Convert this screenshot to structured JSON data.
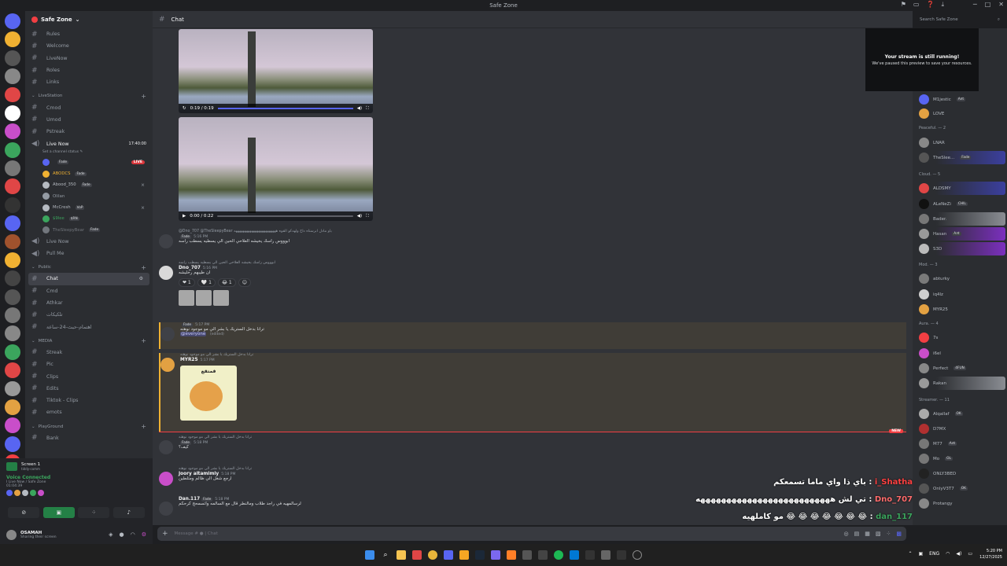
{
  "window": {
    "title": "Safe Zone",
    "controls": [
      "─",
      "□",
      "✕"
    ],
    "top_icons": [
      "⚑",
      "▭",
      "❓",
      "⤓"
    ]
  },
  "server": {
    "name": "Safe Zone",
    "name_suffix": "⌄"
  },
  "channels_top": [
    "Rules",
    "Welcome",
    "LiveNow",
    "Roles",
    "Links"
  ],
  "category_livestation": "LiveStation",
  "channels_livestation": [
    "Cmod",
    "Umod",
    "Pstreak"
  ],
  "voice_live_now": {
    "name": "Live Now",
    "count": "17:40:00",
    "status": "Set a channel status ✎"
  },
  "voice_users": [
    {
      "name": "",
      "tag": "Fade",
      "live": "LIVE",
      "color": "#5865f2"
    },
    {
      "name": "ABODCS",
      "tag": "Fade",
      "color": "#f0b132"
    },
    {
      "name": "Abood_350",
      "tag": "Fade",
      "color": "#b5bac1",
      "mute": "⨯"
    },
    {
      "name": "Olilan",
      "color": "#949ba4"
    },
    {
      "name": "McCresh",
      "tag": "VoP",
      "color": "#b5bac1",
      "mute": "⨯"
    },
    {
      "name": "$9lee",
      "tag": "$RN",
      "color": "#3ba55d"
    },
    {
      "name": "TheSleepyBear",
      "tag": "Fade",
      "color": "#72767d"
    }
  ],
  "voice_extra": [
    "Live Now",
    "Pull Me"
  ],
  "category_public": "Public",
  "channels_public": [
    "Chat",
    "Cmd",
    "Athkar",
    "تلكيكات",
    "اهتمام-حبث-24-ساعة"
  ],
  "category_media": "MEDIA",
  "channels_media": [
    "Streak",
    "Pic",
    "Clips",
    "Edits",
    "Tiktok - Clips",
    "emots"
  ],
  "category_playground": "PlayGround",
  "channels_playground": [
    "Bank"
  ],
  "screen_share": {
    "title": "Screen 1",
    "sub": "tiddy-comm"
  },
  "voice_connected": {
    "label": "Voice Connected",
    "channel": "I Live Now / Safe Zone",
    "time": "01:04:39"
  },
  "user": {
    "name": "OSAMAH",
    "status": "Sharing their screen"
  },
  "chat_header": {
    "channel": "Chat"
  },
  "search": {
    "placeholder": "Search Safe Zone",
    "icon": "⌕"
  },
  "videos": [
    {
      "time": "0:19 / 0:19",
      "progress": 1.0
    },
    {
      "time": "0:00 / 0:22",
      "progress": 0.0
    }
  ],
  "messages": [
    {
      "reply": "@Dno_707 @TheSleepyBear ياو مادل ابرستاه داخ ولهدكو القوه ههههههههههههههههههههههههه",
      "name": "",
      "tag": "Fade",
      "time": "5:16 PM",
      "text": "ابوووس راسك يخيشه العلاحي الحين الي يسطيه يسطب راسه",
      "avatar": "#3f4147"
    },
    {
      "reply": "ابوووس راسك يخيشه العلاحي الحين الي يسطيه يسطب راسه",
      "name": "Dno_707",
      "tag": "",
      "time": "5:16 PM",
      "text": "ان طيبهم رخليشه",
      "avatar": "#d9d9d9",
      "reactions": [
        "❤ 1",
        "🤍 1",
        "😂 1"
      ]
    },
    {
      "reply": "",
      "name": "",
      "tag": "Fade",
      "time": "5:17 PM",
      "text": "ترانا بدخل الستريك يا بشر الي مو موجود نوهته",
      "mention": "@everyone",
      "edited": "(edited)",
      "avatar": "#3f4147"
    },
    {
      "reply": "ترانا بدخل الستريك يا بشر الي مو موجود نوهته",
      "name": "MYR25",
      "tag": "",
      "time": "5:17 PM",
      "text": "",
      "sticker": "قمتقع",
      "avatar": "#e3a142"
    },
    {
      "reply": "ترانا بدخل الستريك يا بشر الي مو موجود نوهته",
      "name": "",
      "tag": "Fade",
      "time": "5:18 PM",
      "text": "كيف؟",
      "avatar": "#3f4147"
    },
    {
      "reply": "ترانا بدخل الستريك يا بشر الي مو موجود نوهته",
      "name": "Joory altamimiy",
      "tag": "",
      "time": "5:18 PM",
      "text": "ارجع شغل الي ظالم ومتلطين",
      "avatar": "#c94ec9"
    },
    {
      "reply": "",
      "name": "Dan.117",
      "tag": "Fade",
      "time": "5:18 PM",
      "text": "لرسالمهيه في راجد طلاب ومالنطر قال مع السالمه واتسمحح كرحكم",
      "avatar": "#3f4147"
    }
  ],
  "new_badge": "NEW",
  "composer": {
    "placeholder": "Message # ● | Chat"
  },
  "overlay": [
    {
      "name": "i_Shatha",
      "text": "باي ذا واي ماما تسمعكم :",
      "color": "#ff4040"
    },
    {
      "name": "Dno_707",
      "text": "تي لش ههههههههههههههههههههههههههه :",
      "color": "#ff6b6b"
    },
    {
      "name": "dan_117",
      "text": "مو كاملهيه 😂 😂 😂 😂 😂 😂 😂 :",
      "color": "#3ba55d"
    }
  ],
  "stream_notice": {
    "title": "Your stream is still running!",
    "sub": "We've paused this preview to save your resources."
  },
  "members": {
    "groups": [
      "Peaceful. — 2",
      "Cloud. — 5",
      "Mod. — 3",
      "Aura. — 4",
      "Streamer. — 11"
    ],
    "list": [
      {
        "name": "M1jestic",
        "tag": "Aлt",
        "style": "",
        "color": "#5865f2"
      },
      {
        "name": "LOVE",
        "tag": "",
        "style": "",
        "color": "#e3a142"
      },
      {
        "name": "LNAR",
        "tag": "",
        "style": "",
        "color": "#888"
      },
      {
        "name": "TheSlee...",
        "tag": "Fade",
        "style": "blue",
        "color": "#555"
      },
      {
        "name": "ALDSMY",
        "tag": "",
        "style": "blue",
        "color": "#e04646"
      },
      {
        "name": "ALeNeZi",
        "tag": "CHIL",
        "style": "",
        "color": "#111"
      },
      {
        "name": "Bader.",
        "tag": "",
        "style": "gray",
        "color": "#777"
      },
      {
        "name": "Hasan",
        "tag": "Aлt",
        "style": "purple",
        "color": "#999"
      },
      {
        "name": "S3D",
        "tag": "",
        "style": "purple",
        "color": "#bbb"
      },
      {
        "name": "abturky",
        "tag": "",
        "style": "",
        "color": "#7a7a7a"
      },
      {
        "name": "iq4lz",
        "tag": "",
        "style": "",
        "color": "#cfcfcf"
      },
      {
        "name": "MYR25",
        "tag": "",
        "style": "",
        "color": "#e3a142"
      },
      {
        "name": "7s",
        "tag": "",
        "style": "",
        "color": "#f23f43"
      },
      {
        "name": "i6el",
        "tag": "",
        "style": "",
        "color": "#c94ec9"
      },
      {
        "name": "Perfect",
        "tag": "4FUN",
        "style": "",
        "color": "#888"
      },
      {
        "name": "Rakan",
        "tag": "",
        "style": "gray",
        "color": "#999"
      },
      {
        "name": "Alqallaf",
        "tag": "OK",
        "style": "",
        "color": "#aaa"
      },
      {
        "name": "D7MX",
        "tag": "",
        "style": "",
        "color": "#b03030"
      },
      {
        "name": "M77",
        "tag": "Aлt",
        "style": "",
        "color": "#777"
      },
      {
        "name": "Mo",
        "tag": "OL",
        "style": "",
        "color": "#777"
      },
      {
        "name": "ONLY3BED",
        "tag": "",
        "style": "",
        "color": "#222"
      },
      {
        "name": "OnlyV3T7",
        "tag": "OK",
        "style": "",
        "color": "#555"
      },
      {
        "name": "Protangy",
        "tag": "",
        "style": "",
        "color": "#888"
      }
    ]
  },
  "taskbar": {
    "time": "5:20 PM",
    "date": "12/27/2025",
    "lang": "ENG"
  }
}
